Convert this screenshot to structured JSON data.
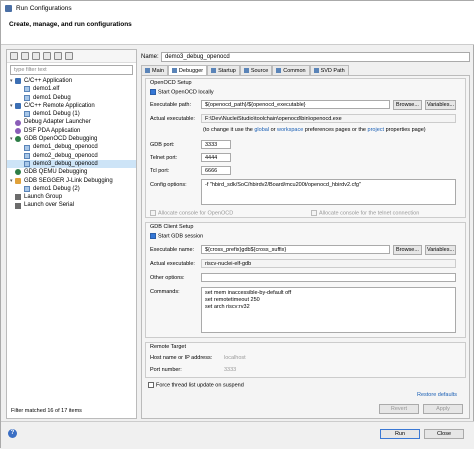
{
  "window": {
    "title": "Run Configurations"
  },
  "banner": {
    "text": "Create, manage, and run configurations"
  },
  "filter": {
    "placeholder": "type filter text"
  },
  "tree": [
    {
      "label": "C/C++ Application",
      "level": 0,
      "icon": "c-app-icon",
      "expanded": true
    },
    {
      "label": "demo1.elf",
      "level": 1,
      "icon": "config-icon"
    },
    {
      "label": "demo1 Debug",
      "level": 1,
      "icon": "config-icon"
    },
    {
      "label": "C/C++ Remote Application",
      "level": 0,
      "icon": "c-remote-icon",
      "expanded": true
    },
    {
      "label": "demo1 Debug (1)",
      "level": 1,
      "icon": "config-icon"
    },
    {
      "label": "Debug Adapter Launcher",
      "level": 0,
      "icon": "launcher-icon"
    },
    {
      "label": "DSF PDA Application",
      "level": 0,
      "icon": "pda-icon"
    },
    {
      "label": "GDB OpenOCD Debugging",
      "level": 0,
      "icon": "gdb-icon",
      "expanded": true
    },
    {
      "label": "demo1_debug_openocd",
      "level": 1,
      "icon": "config-icon"
    },
    {
      "label": "demo2_debug_openocd",
      "level": 1,
      "icon": "config-icon"
    },
    {
      "label": "demo3_debug_openocd",
      "level": 1,
      "icon": "config-icon",
      "selected": true
    },
    {
      "label": "GDB QEMU Debugging",
      "level": 0,
      "icon": "qemu-icon"
    },
    {
      "label": "GDB SEGGER J-Link Debugging",
      "level": 0,
      "icon": "segger-icon",
      "expanded": true
    },
    {
      "label": "demo1 Debug (2)",
      "level": 1,
      "icon": "config-icon"
    },
    {
      "label": "Launch Group",
      "level": 0,
      "icon": "launch-group-icon"
    },
    {
      "label": "Launch over Serial",
      "level": 0,
      "icon": "serial-icon"
    }
  ],
  "tree_status": "Filter matched 16 of 17 items",
  "name": {
    "label": "Name:",
    "value": "demo3_debug_openocd"
  },
  "tabs": [
    "Main",
    "Debugger",
    "Startup",
    "Source",
    "Common",
    "SVD Path"
  ],
  "openocd": {
    "group_title": "OpenOCD Setup",
    "start_locally": "Start OpenOCD locally",
    "exec_label": "Executable path:",
    "exec_value": "${openocd_path}/${openocd_executable}",
    "actual_label": "Actual executable:",
    "actual_value": "F:\\Dev\\NucleiStudio\\toolchain\\openocd\\bin\\openocd.exe",
    "hint_prefix": "(to change it use the",
    "hint_global": "global",
    "hint_or": "or",
    "hint_workspace": "workspace",
    "hint_mid": "preferences pages or the",
    "hint_project": "project",
    "hint_suffix": "properties page)",
    "gdb_port_label": "GDB port:",
    "gdb_port": "3333",
    "telnet_port_label": "Telnet port:",
    "telnet_port": "4444",
    "tcl_port_label": "Tcl port:",
    "tcl_port": "6666",
    "config_label": "Config options:",
    "config_value": "-f \"hbird_sdk/SoC/hbirdv2/Board/mcu200t/openocd_hbirdv2.cfg\"",
    "alloc_console": "Allocate console for OpenOCD",
    "alloc_telnet": "Allocate console for the telnet connection"
  },
  "gdbclient": {
    "group_title": "GDB Client Setup",
    "start_session": "Start GDB session",
    "exec_label": "Executable name:",
    "exec_value": "${cross_prefix}gdb${cross_suffix}",
    "actual_label": "Actual executable:",
    "actual_value": "riscv-nuclei-elf-gdb",
    "other_label": "Other options:",
    "commands_label": "Commands:",
    "commands": [
      "set mem inaccessible-by-default off",
      "set remotetimeout 250",
      "set arch riscv:rv32"
    ]
  },
  "remote": {
    "group_title": "Remote Target",
    "host_label": "Host name or IP address:",
    "host_value": "localhost",
    "port_label": "Port number:",
    "port_value": "3333"
  },
  "force_thread": "Force thread list update on suspend",
  "restore_defaults": "Restore defaults",
  "buttons": {
    "browse": "Browse...",
    "variables": "Variables...",
    "revert": "Revert",
    "apply": "Apply",
    "run": "Run",
    "close": "Close"
  },
  "help_glyph": "?"
}
